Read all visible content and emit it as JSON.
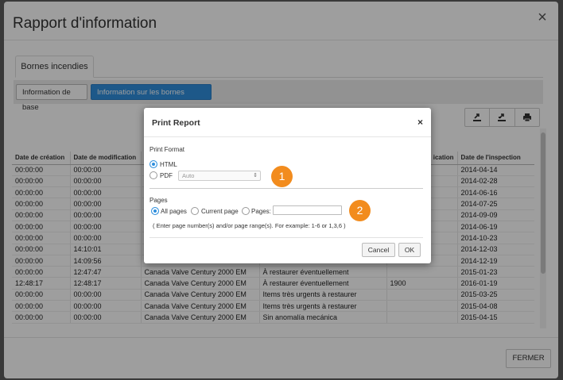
{
  "modal": {
    "title": "Rapport d'information",
    "close_icon": "×",
    "tab_main": "Bornes incendies",
    "subtabs": [
      "Information de base",
      "Information sur les bornes incendies"
    ],
    "footer_close": "FERMER"
  },
  "table": {
    "headers": [
      "Date de création",
      "Date de modification",
      "",
      "",
      "",
      "Date de l'inspection"
    ],
    "header_visible_right": "ication",
    "rows": [
      [
        "00:00:00",
        "00:00:00",
        "",
        "",
        "",
        "2014-04-14"
      ],
      [
        "00:00:00",
        "00:00:00",
        "",
        "",
        "",
        "2014-02-28"
      ],
      [
        "00:00:00",
        "00:00:00",
        "",
        "",
        "",
        "2014-06-16"
      ],
      [
        "00:00:00",
        "00:00:00",
        "",
        "",
        "",
        "2014-07-25"
      ],
      [
        "00:00:00",
        "00:00:00",
        "",
        "",
        "",
        "2014-09-09"
      ],
      [
        "00:00:00",
        "00:00:00",
        "",
        "",
        "",
        "2014-06-19"
      ],
      [
        "00:00:00",
        "00:00:00",
        "",
        "",
        "",
        "2014-10-23"
      ],
      [
        "00:00:00",
        "14:10:01",
        "",
        "",
        "",
        "2014-12-03"
      ],
      [
        "00:00:00",
        "14:09:56",
        "",
        "",
        "",
        "2014-12-19"
      ],
      [
        "00:00:00",
        "12:47:47",
        "Canada Valve Century 2000 EM",
        "À restaurer éventuellement",
        "",
        "2015-01-23"
      ],
      [
        "12:48:17",
        "12:48:17",
        "Canada Valve Century 2000 EM",
        "À restaurer éventuellement",
        "1900",
        "2016-01-19"
      ],
      [
        "00:00:00",
        "00:00:00",
        "Canada Valve Century 2000 EM",
        "Items très urgents à restaurer",
        "",
        "2015-03-25"
      ],
      [
        "00:00:00",
        "00:00:00",
        "Canada Valve Century 2000 EM",
        "Items très urgents à restaurer",
        "",
        "2015-04-08"
      ],
      [
        "00:00:00",
        "00:00:00",
        "Canada Valve Century 2000 EM",
        "Sin anomalía mecánica",
        "",
        "2015-04-15"
      ]
    ]
  },
  "dialog": {
    "title": "Print Report",
    "close": "×",
    "format_label": "Print Format",
    "opt_html": "HTML",
    "opt_pdf": "PDF",
    "pdf_select_value": "Auto",
    "pages_label": "Pages",
    "opt_all": "All pages",
    "opt_current": "Current page",
    "opt_pages": "Pages:",
    "hint": "( Enter page number(s) and/or page range(s). For example: 1-6 or 1,3,6 )",
    "cancel": "Cancel",
    "ok": "OK"
  },
  "callouts": [
    "1",
    "2"
  ]
}
